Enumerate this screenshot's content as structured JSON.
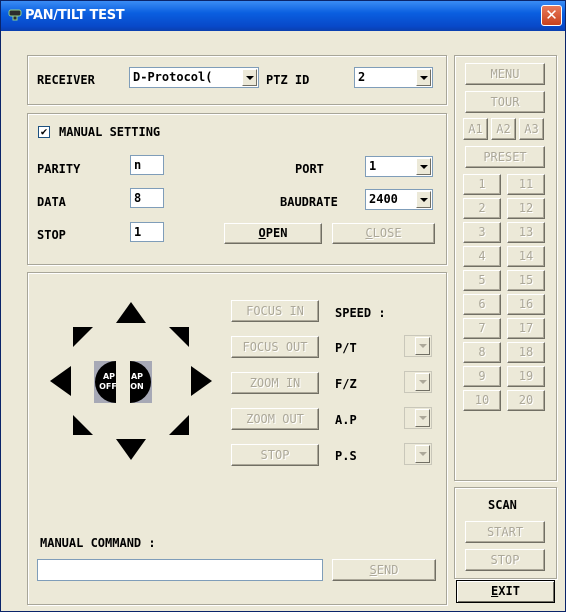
{
  "window": {
    "title": "PAN/TILT TEST",
    "close_glyph": "✕"
  },
  "receiver": {
    "label": "RECEIVER",
    "value": "D-Protocol(",
    "ptz_id_label": "PTZ ID",
    "ptz_id_value": "2"
  },
  "manual_setting": {
    "checkbox_label": "MANUAL SETTING",
    "checked": true,
    "check_glyph": "✔",
    "parity_label": "PARITY",
    "parity_value": "n",
    "data_label": "DATA",
    "data_value": "8",
    "stop_label": "STOP",
    "stop_value": "1",
    "port_label": "PORT",
    "port_value": "1",
    "baudrate_label": "BAUDRATE",
    "baudrate_value": "2400",
    "open_button_first": "O",
    "open_button_rest": "PEN",
    "close_button_first": "C",
    "close_button_rest": "LOSE"
  },
  "control": {
    "ap_off": [
      "AP",
      "OFF"
    ],
    "ap_on": [
      "AP",
      "ON"
    ],
    "focus_in": "FOCUS IN",
    "focus_out": "FOCUS OUT",
    "zoom_in": "ZOOM IN",
    "zoom_out": "ZOOM OUT",
    "stop": "STOP",
    "speed_label": "SPEED :",
    "pt_label": "P/T",
    "fz_label": "F/Z",
    "ap_label": "A.P",
    "ps_label": "P.S",
    "manual_command_label": "MANUAL COMMAND :",
    "manual_command_value": "",
    "send_first": "S",
    "send_rest": "END"
  },
  "side": {
    "menu": "MENU",
    "tour": "TOUR",
    "a1": "A1",
    "a2": "A2",
    "a3": "A3",
    "preset": "PRESET",
    "presets_left": [
      "1",
      "2",
      "3",
      "4",
      "5",
      "6",
      "7",
      "8",
      "9",
      "10"
    ],
    "presets_right": [
      "11",
      "12",
      "13",
      "14",
      "15",
      "16",
      "17",
      "18",
      "19",
      "20"
    ],
    "scan_label": "SCAN",
    "scan_start": "START",
    "scan_stop": "STOP",
    "exit_first": "E",
    "exit_rest": "XIT"
  },
  "colors": {
    "title_bar": "#0a5fe0",
    "face": "#ece9d8",
    "disabled_text": "#aca899",
    "close_button": "#d8552e"
  }
}
